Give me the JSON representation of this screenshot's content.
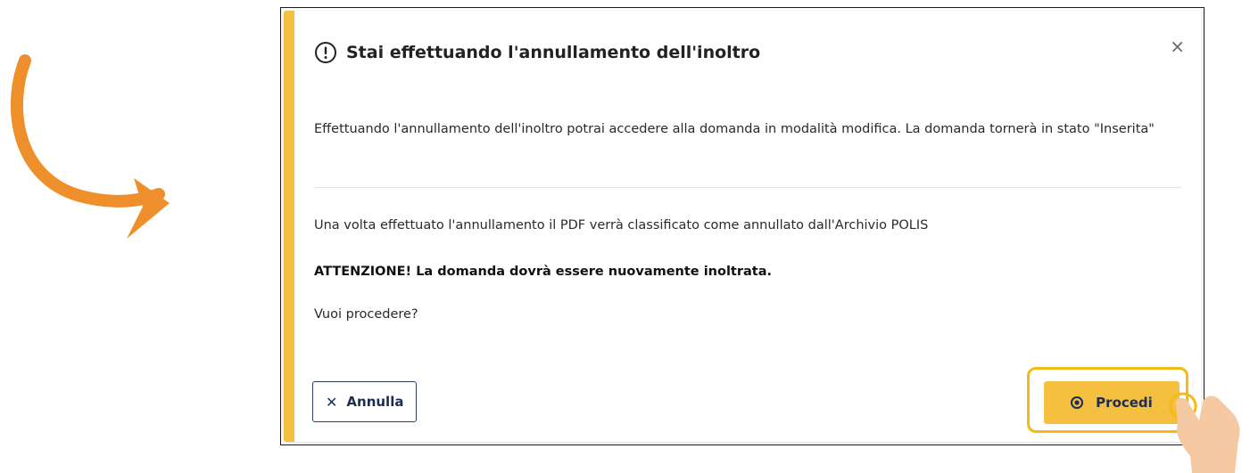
{
  "dialog": {
    "title": "Stai effettuando l'annullamento dell'inoltro",
    "close_symbol": "×",
    "paragraph_1": "Effettuando l'annullamento dell'inoltro potrai accedere alla domanda in modalità modifica. La domanda tornerà in stato \"Inserita\"",
    "paragraph_2": "Una volta effettuato l'annullamento il PDF verrà classificato come annullato dall'Archivio POLIS",
    "warning": "ATTENZIONE! La domanda dovrà essere nuovamente inoltrata.",
    "question": "Vuoi procedere?",
    "cancel_label": "Annulla",
    "cancel_icon_symbol": "✕",
    "proceed_label": "Procedi"
  },
  "icons": {
    "header_icon": "exclamation-circle-icon",
    "cancel_icon": "close-icon",
    "proceed_icon": "dot-circle-icon"
  },
  "colors": {
    "accent": "#f5bf3f",
    "highlight": "#f4bb15",
    "primary_text": "#1e2d55",
    "arrow": "#ef8f2c",
    "hand": "#f5c9a1"
  }
}
